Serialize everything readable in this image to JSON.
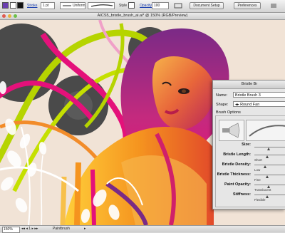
{
  "control_bar": {
    "stroke_label": "Stroke",
    "stroke_weight": "1 pt",
    "variable_width": "Uniform",
    "style_label": "Style",
    "opacity_label": "Opacity",
    "opacity_value": "100",
    "document_setup_button": "Document Setup",
    "preferences_button": "Preferences"
  },
  "document": {
    "title": "AICS5_bristle_brush_ai.ai* @ 150% (RGB/Preview)"
  },
  "status_bar": {
    "zoom": "150%",
    "tool": "Paintbrush"
  },
  "bristle_panel": {
    "title": "Bristle Br",
    "name_label": "Name:",
    "name_value": "Bristle Brush 3",
    "shape_label": "Shape:",
    "shape_value": "Round Fan",
    "options_heading": "Brush Options",
    "sliders": [
      {
        "label": "Size:",
        "hint": "",
        "level": 0.45
      },
      {
        "label": "Bristle Length:",
        "hint": "Short",
        "level": 0.4
      },
      {
        "label": "Bristle Density:",
        "hint": "Low",
        "level": 0.35
      },
      {
        "label": "Bristle Thickness:",
        "hint": "Fine",
        "level": 0.4
      },
      {
        "label": "Paint Opacity:",
        "hint": "Translucent",
        "level": 0.45
      },
      {
        "label": "Stiffness:",
        "hint": "Flexible",
        "level": 0.4
      }
    ]
  },
  "colors": {
    "canvas_bg": "#f1e3d6",
    "dark_blob": "#4a4a4a",
    "magenta": "#e4117a",
    "lime": "#b6d400",
    "orange": "#f5941f",
    "purple": "#7a2a86"
  }
}
